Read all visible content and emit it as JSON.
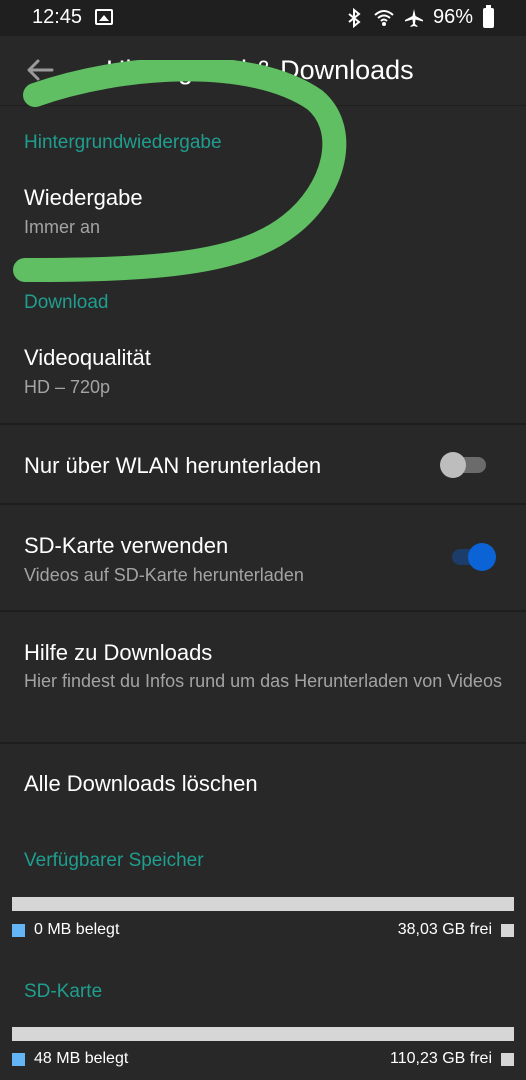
{
  "status_bar": {
    "time": "12:45",
    "battery": "96%",
    "icons": [
      "image-icon",
      "bluetooth-icon",
      "wifi-icon",
      "airplane-icon",
      "battery-icon"
    ]
  },
  "app_bar": {
    "title": "Hintergrund & Downloads",
    "back_icon": "arrow-back-icon"
  },
  "sections": {
    "background": {
      "header": "Hintergrundwiedergabe",
      "playback_title": "Wiedergabe",
      "playback_value": "Immer an"
    },
    "download": {
      "header": "Download",
      "quality_title": "Videoqualität",
      "quality_value": "HD – 720p",
      "wifi_only_label": "Nur über WLAN herunterladen",
      "wifi_only_on": false,
      "sd_card_title": "SD-Karte verwenden",
      "sd_card_subtitle": "Videos auf SD-Karte herunterladen",
      "sd_card_on": true,
      "help_title": "Hilfe zu Downloads",
      "help_subtitle": "Hier findest du Infos rund um das Herunterladen von Videos",
      "delete_all": "Alle Downloads löschen"
    },
    "storage": {
      "header": "Verfügbarer Speicher",
      "used": "0 MB belegt",
      "free": "38,03 GB frei"
    },
    "sd_storage": {
      "header": "SD-Karte",
      "used": "48 MB belegt",
      "free": "110,23 GB frei"
    }
  },
  "colors": {
    "background": "#282828",
    "accent_teal": "#1f9e8f",
    "toggle_on": "#0b63d6",
    "used_legend": "#64b5f6",
    "bar_free": "#d6d6d6",
    "scribble": "#5fbf62"
  }
}
